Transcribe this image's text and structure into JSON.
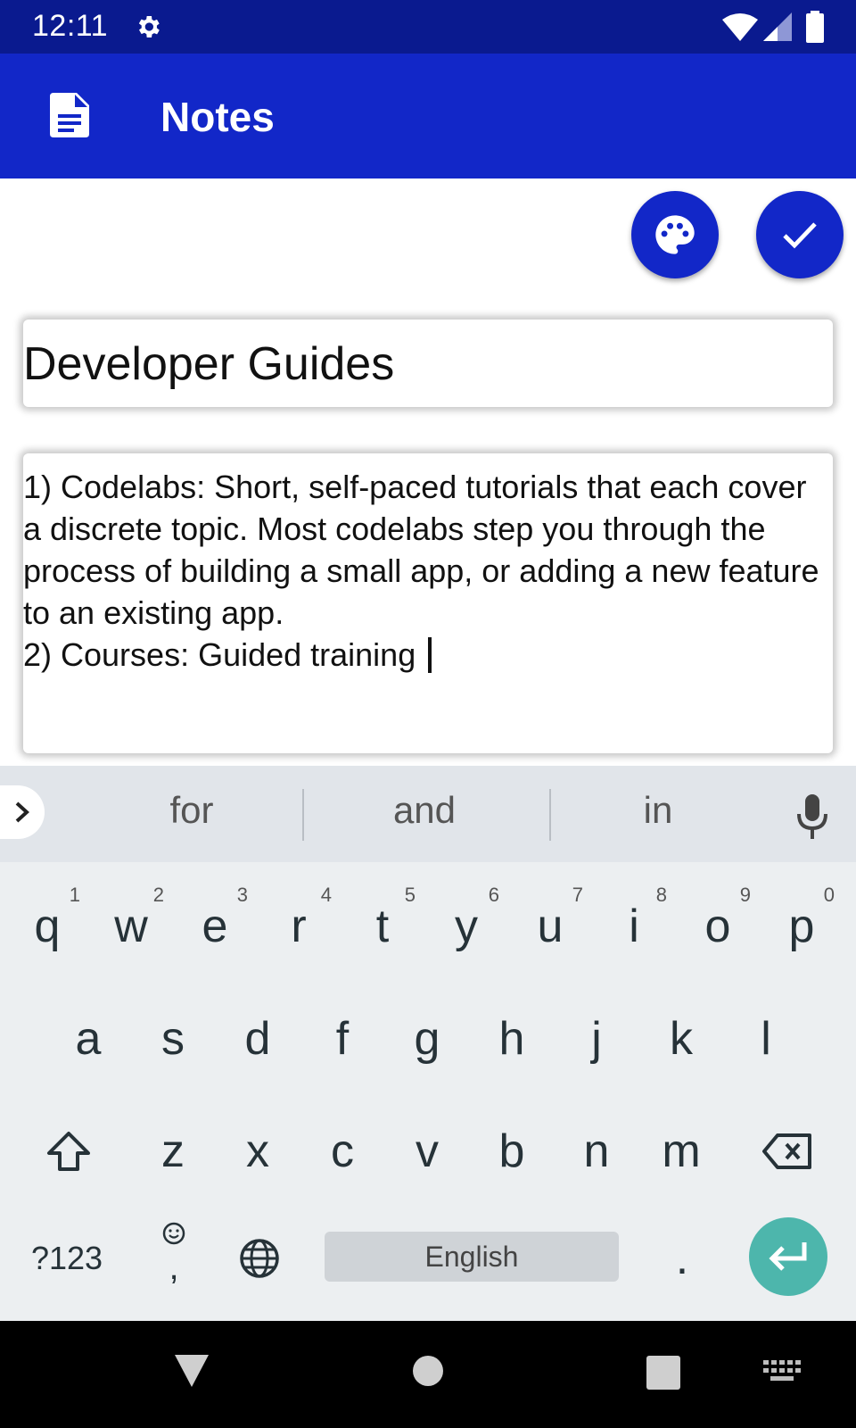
{
  "status_bar": {
    "time": "12:11"
  },
  "app_bar": {
    "title": "Notes"
  },
  "note": {
    "title": "Developer Guides",
    "body": "1) Codelabs: Short, self-paced tutorials that each cover a discrete topic. Most codelabs step you through the process of building a small app, or adding a new feature to an existing app.\n2) Courses: Guided training "
  },
  "keyboard": {
    "suggestions": [
      "for",
      "and",
      "in"
    ],
    "row1": [
      {
        "key": "q",
        "hint": "1"
      },
      {
        "key": "w",
        "hint": "2"
      },
      {
        "key": "e",
        "hint": "3"
      },
      {
        "key": "r",
        "hint": "4"
      },
      {
        "key": "t",
        "hint": "5"
      },
      {
        "key": "y",
        "hint": "6"
      },
      {
        "key": "u",
        "hint": "7"
      },
      {
        "key": "i",
        "hint": "8"
      },
      {
        "key": "o",
        "hint": "9"
      },
      {
        "key": "p",
        "hint": "0"
      }
    ],
    "row2": [
      "a",
      "s",
      "d",
      "f",
      "g",
      "h",
      "j",
      "k",
      "l"
    ],
    "row3": [
      "z",
      "x",
      "c",
      "v",
      "b",
      "n",
      "m"
    ],
    "symbols_label": "?123",
    "comma": ",",
    "space_label": "English",
    "period": "."
  },
  "colors": {
    "status_bar": "#0a1a8f",
    "app_bar": "#1227c8",
    "enter_key": "#4db6ac"
  },
  "icons": [
    "gear-icon",
    "wifi-icon",
    "signal-icon",
    "battery-icon",
    "document-icon",
    "palette-icon",
    "check-icon",
    "chevron-right-icon",
    "mic-icon",
    "shift-icon",
    "emoji-icon",
    "globe-icon",
    "backspace-icon",
    "enter-icon",
    "back-icon",
    "home-icon",
    "recents-icon",
    "keyboard-icon"
  ]
}
